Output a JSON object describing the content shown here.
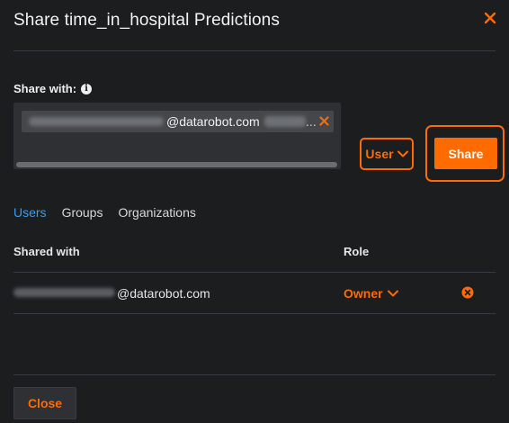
{
  "dialog": {
    "title": "Share time_in_hospital Predictions"
  },
  "share_with": {
    "label": "Share with:",
    "chip_email_suffix": "@datarobot.com",
    "chip_ellipsis": "..."
  },
  "role_select": {
    "value": "User"
  },
  "share_button": {
    "label": "Share"
  },
  "tabs": [
    {
      "label": "Users",
      "active": true
    },
    {
      "label": "Groups",
      "active": false
    },
    {
      "label": "Organizations",
      "active": false
    }
  ],
  "table": {
    "columns": [
      "Shared with",
      "Role"
    ],
    "rows": [
      {
        "email_suffix": "@datarobot.com",
        "role": "Owner"
      }
    ]
  },
  "footer": {
    "close_label": "Close"
  },
  "colors": {
    "accent": "#ff6b00",
    "active_tab": "#3d9be9",
    "background": "#1c1d1f"
  }
}
